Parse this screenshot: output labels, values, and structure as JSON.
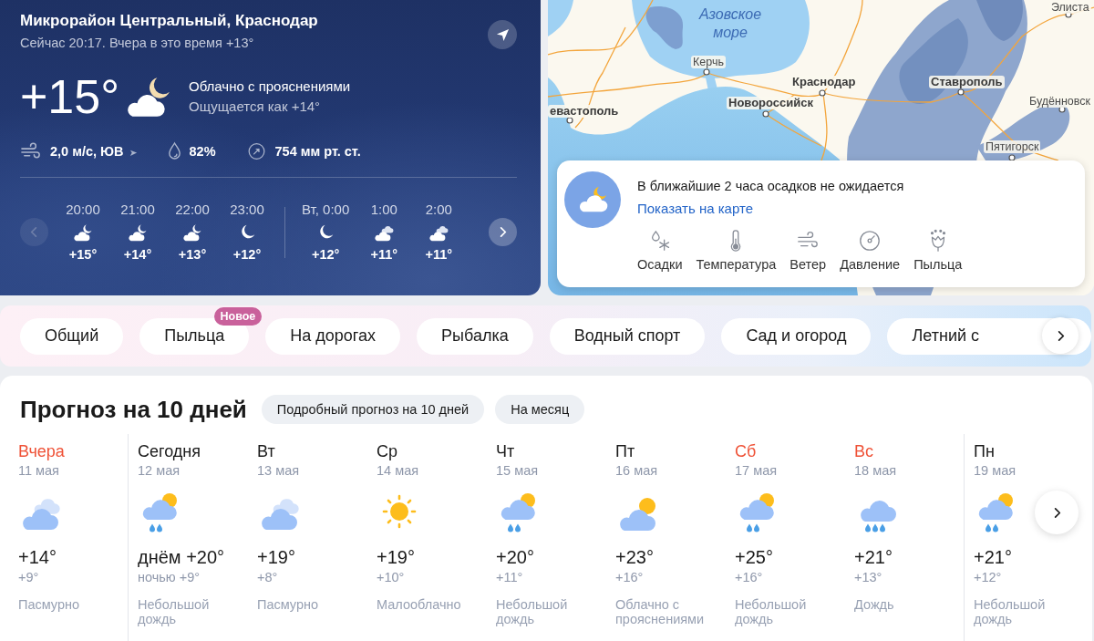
{
  "current": {
    "location": "Микрорайон Центральный, Краснодар",
    "subtitle": "Сейчас 20:17. Вчера в это время +13°",
    "temperature": "+15°",
    "kind": "cloud-moon",
    "condition": "Облачно с прояснениями",
    "feels_like": "Ощущается как +14°",
    "details": [
      {
        "kind": "wind",
        "value": "2,0 м/с, ЮВ"
      },
      {
        "kind": "humidity",
        "value": "82%"
      },
      {
        "kind": "pressure",
        "value": "754 мм рт. ст."
      }
    ]
  },
  "hourly": {
    "prev_disabled": true,
    "items": [
      {
        "time": "20:00",
        "kind": "cloud-moon",
        "temperature": "+15°",
        "day_start": false
      },
      {
        "time": "21:00",
        "kind": "cloud-moon",
        "temperature": "+14°",
        "day_start": false
      },
      {
        "time": "22:00",
        "kind": "cloud-moon",
        "temperature": "+13°",
        "day_start": false
      },
      {
        "time": "23:00",
        "kind": "moon",
        "temperature": "+12°",
        "day_start": false
      },
      {
        "time": "Вт, 0:00",
        "kind": "moon",
        "temperature": "+12°",
        "day_start": true
      },
      {
        "time": "1:00",
        "kind": "cloudy",
        "temperature": "+11°",
        "day_start": false
      },
      {
        "time": "2:00",
        "kind": "cloudy",
        "temperature": "+11°",
        "day_start": false
      }
    ]
  },
  "map": {
    "labels": [
      {
        "kind": "sea",
        "text": "Азовское море"
      },
      {
        "kind": "town",
        "text": "Керчь"
      },
      {
        "kind": "city",
        "text": "Краснодар"
      },
      {
        "kind": "city",
        "text": "Новороссийск"
      },
      {
        "kind": "city",
        "text": "евастополь"
      },
      {
        "kind": "city",
        "text": "Ставрополь"
      },
      {
        "kind": "town",
        "text": "Будённовск"
      },
      {
        "kind": "town",
        "text": "Пятигорск"
      },
      {
        "kind": "town",
        "text": "Элиста"
      }
    ],
    "nowcast": {
      "message": "В ближайшие 2 часа осадков не ожидается",
      "link": "Показать на карте",
      "layers": [
        {
          "kind": "precipitation",
          "label": "Осадки"
        },
        {
          "kind": "temperature",
          "label": "Температура"
        },
        {
          "kind": "wind",
          "label": "Ветер"
        },
        {
          "kind": "pressure",
          "label": "Давление"
        },
        {
          "kind": "pollen",
          "label": "Пыльца"
        }
      ]
    }
  },
  "categories": [
    {
      "label": "Общий"
    },
    {
      "label": "Пыльца",
      "badge": "Новое"
    },
    {
      "label": "На дорогах"
    },
    {
      "label": "Рыбалка"
    },
    {
      "label": "Водный спорт"
    },
    {
      "label": "Сад и огород"
    },
    {
      "label": "Летний с"
    }
  ],
  "forecast": {
    "title": "Прогноз на 10 дней",
    "buttons": [
      "Подробный прогноз на 10 дней",
      "На месяц"
    ],
    "days": [
      {
        "name": "Вчера",
        "date": "11 мая",
        "kind": "overcast",
        "day_temperature": "+14°",
        "night_temperature": "+9°",
        "condition": "Пасмурно",
        "color": "#ef5237",
        "divider_before": false
      },
      {
        "name": "Сегодня",
        "date": "12 мая",
        "kind": "light-rain",
        "day_temperature": "днём +20°",
        "night_temperature": "ночью +9°",
        "condition": "Небольшой дождь",
        "color": "#1a1a1a",
        "divider_before": true
      },
      {
        "name": "Вт",
        "date": "13 мая",
        "kind": "overcast",
        "day_temperature": "+19°",
        "night_temperature": "+8°",
        "condition": "Пасмурно",
        "color": "#1a1a1a",
        "divider_before": false
      },
      {
        "name": "Ср",
        "date": "14 мая",
        "kind": "clear",
        "day_temperature": "+19°",
        "night_temperature": "+10°",
        "condition": "Малооблачно",
        "color": "#1a1a1a",
        "divider_before": false
      },
      {
        "name": "Чт",
        "date": "15 мая",
        "kind": "light-rain",
        "day_temperature": "+20°",
        "night_temperature": "+11°",
        "condition": "Небольшой дождь",
        "color": "#1a1a1a",
        "divider_before": false
      },
      {
        "name": "Пт",
        "date": "16 мая",
        "kind": "partly-cloudy",
        "day_temperature": "+23°",
        "night_temperature": "+16°",
        "condition": "Облачно с прояснениями",
        "color": "#1a1a1a",
        "divider_before": false
      },
      {
        "name": "Сб",
        "date": "17 мая",
        "kind": "light-rain",
        "day_temperature": "+25°",
        "night_temperature": "+16°",
        "condition": "Небольшой дождь",
        "color": "#ef5237",
        "divider_before": false
      },
      {
        "name": "Вс",
        "date": "18 мая",
        "kind": "rain",
        "day_temperature": "+21°",
        "night_temperature": "+13°",
        "condition": "Дождь",
        "color": "#ef5237",
        "divider_before": false
      },
      {
        "name": "Пн",
        "date": "19 мая",
        "kind": "light-rain",
        "day_temperature": "+21°",
        "night_temperature": "+12°",
        "condition": "Небольшой дождь",
        "color": "#1a1a1a",
        "divider_before": true
      }
    ]
  }
}
